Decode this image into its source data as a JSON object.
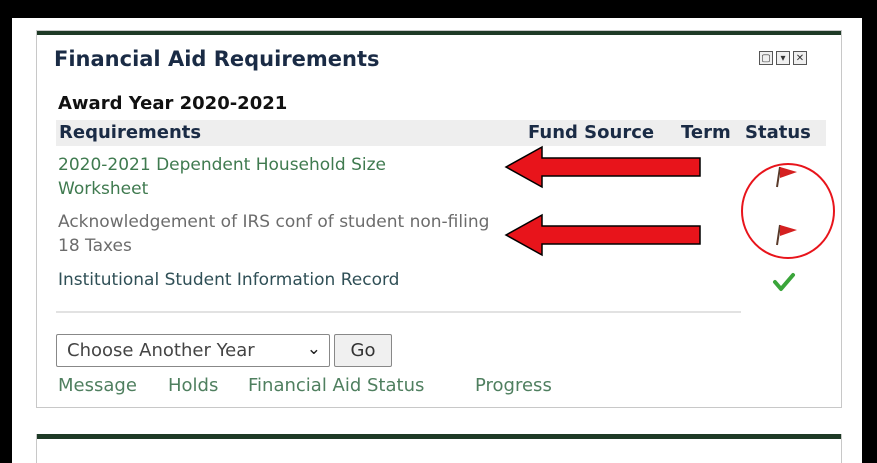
{
  "panel": {
    "title": "Financial Aid Requirements",
    "window_buttons": [
      "▢",
      "▾",
      "✕"
    ]
  },
  "award_year": "Award Year 2020-2021",
  "table": {
    "headers": {
      "requirements": "Requirements",
      "fund_source": "Fund Source",
      "term": "Term",
      "status": "Status"
    },
    "rows": [
      {
        "requirement": "2020-2021 Dependent Household Size Worksheet",
        "status_icon": "red-flag-icon"
      },
      {
        "requirement": "Acknowledgement of IRS conf of student non-filing 18 Taxes",
        "status_icon": "red-flag-icon"
      },
      {
        "requirement": "Institutional Student Information Record",
        "status_icon": "green-check-icon"
      }
    ]
  },
  "year_select": {
    "selected": "Choose Another Year"
  },
  "go_button": "Go",
  "links": [
    "Message",
    "Holds",
    "Financial Aid Status",
    "Progress"
  ],
  "colors": {
    "annotation_red": "#e8141b",
    "flag_red": "#d42020",
    "check_green": "#3aa53a",
    "panel_bar": "#1e3a26"
  }
}
